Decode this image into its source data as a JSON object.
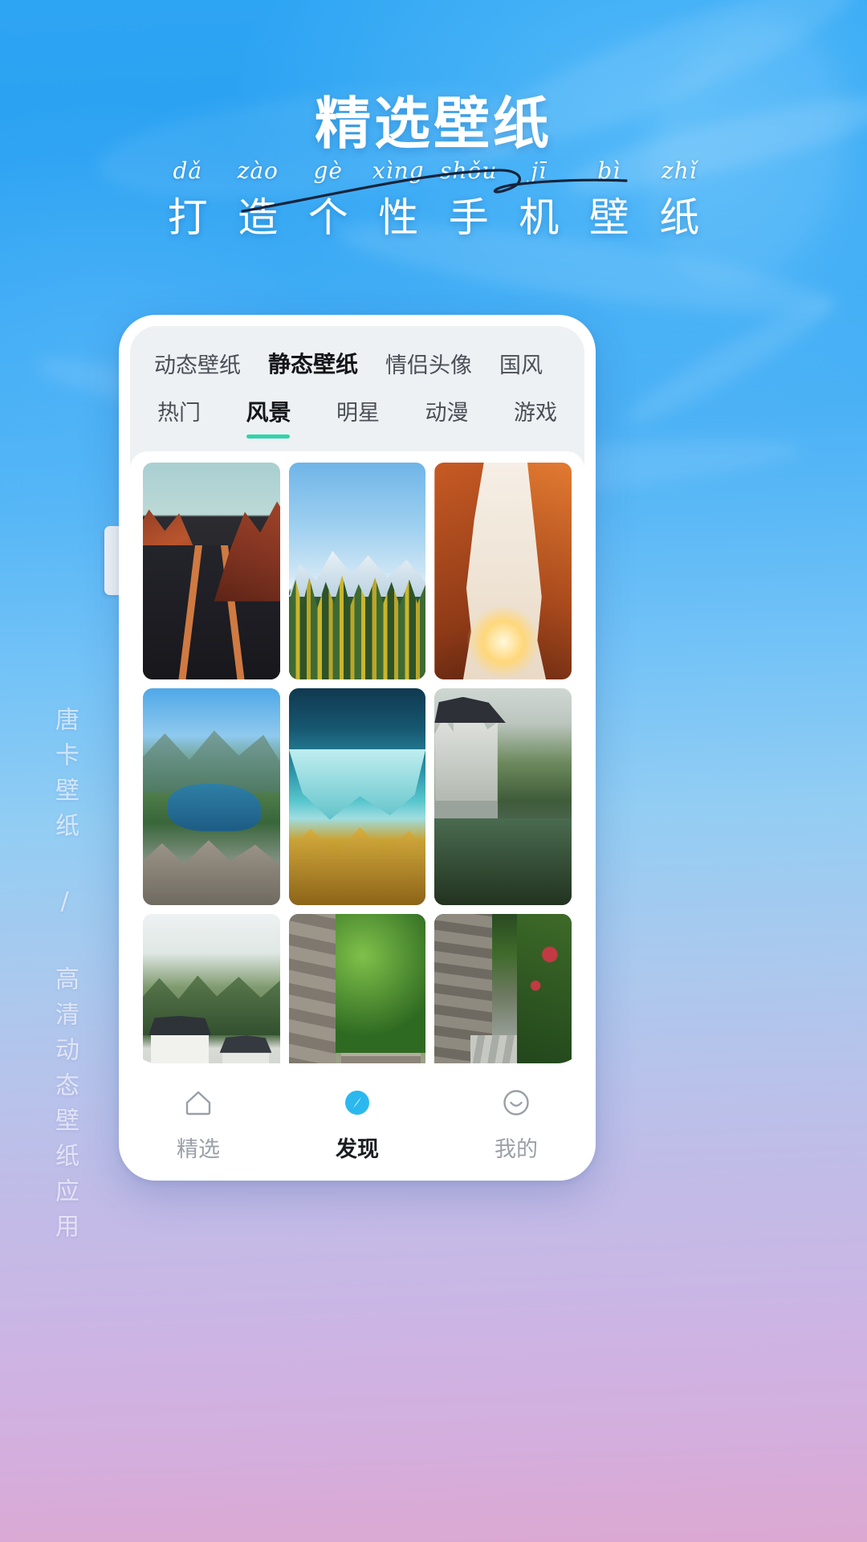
{
  "poster": {
    "main_title": "精选壁纸",
    "pinyin": [
      "dǎ",
      "zào",
      "gè",
      "xìng",
      "shǒu",
      "jī",
      "bì",
      "zhǐ"
    ],
    "hanzi": [
      "打",
      "造",
      "个",
      "性",
      "手",
      "机",
      "壁",
      "纸"
    ],
    "side_text": "唐卡壁纸 / 高清动态壁纸应用",
    "accent_blue": "#2ea5f3",
    "accent_pink": "#dba8d2"
  },
  "app": {
    "primary_tabs": [
      {
        "label": "动态壁纸",
        "active": false
      },
      {
        "label": "静态壁纸",
        "active": true
      },
      {
        "label": "情侣头像",
        "active": false
      },
      {
        "label": "国风",
        "active": false
      }
    ],
    "secondary_tabs": [
      {
        "label": "热门",
        "active": false
      },
      {
        "label": "风景",
        "active": true
      },
      {
        "label": "明星",
        "active": false
      },
      {
        "label": "动漫",
        "active": false
      },
      {
        "label": "游戏",
        "active": false
      }
    ],
    "active_indicator_color": "#2fd5a8",
    "gallery": [
      {
        "name": "desert-road",
        "alt": "红色岩石沙漠公路"
      },
      {
        "name": "snow-mountain-forest",
        "alt": "雪山与金黄松林"
      },
      {
        "name": "canyon-arch-sunset",
        "alt": "红岩拱门日落"
      },
      {
        "name": "lake-valley",
        "alt": "山谷湖泊岩石"
      },
      {
        "name": "turquoise-waterfall",
        "alt": "碧蓝瀑布金色岩石"
      },
      {
        "name": "ancient-town-canal",
        "alt": "古镇水乡河道"
      },
      {
        "name": "white-village",
        "alt": "徽派白墙村落"
      },
      {
        "name": "stone-stairway",
        "alt": "石阶绿荫小径"
      },
      {
        "name": "stone-alley",
        "alt": "石墙花巷"
      }
    ],
    "bottom_nav": [
      {
        "label": "精选",
        "icon": "home-icon",
        "active": false
      },
      {
        "label": "发现",
        "icon": "compass-icon",
        "active": true
      },
      {
        "label": "我的",
        "icon": "smiley-face-icon",
        "active": false
      }
    ]
  }
}
